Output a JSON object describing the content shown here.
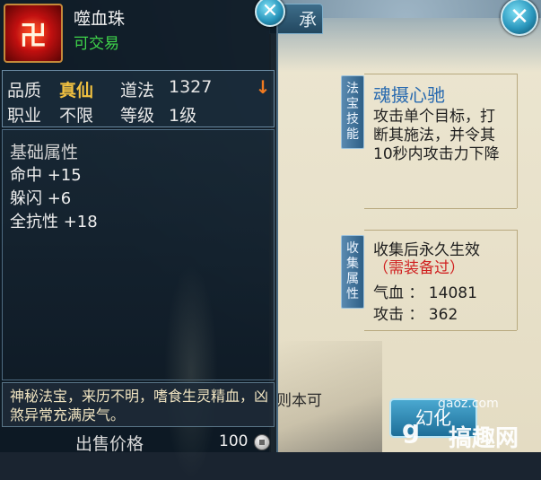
{
  "item": {
    "name": "噬血珠",
    "trade_status": "可交易",
    "icon_glyph": "卍",
    "icon_name": "blood-orb-icon"
  },
  "stats": {
    "quality_label": "品质",
    "quality_value": "真仙",
    "daofa_label": "道法",
    "daofa_value": "1327",
    "class_label": "职业",
    "class_value": "不限",
    "level_label": "等级",
    "level_value": "1级"
  },
  "attributes": {
    "heading": "基础属性",
    "lines": [
      "命中 +15",
      "躲闪 +6",
      "全抗性 +18"
    ]
  },
  "description": "神秘法宝，来历不明，嗜食生灵精血，凶煞异常充满戾气。",
  "sell": {
    "label": "出售价格",
    "price": "100"
  },
  "right_panel": {
    "tab_partial": "承",
    "skill_tag": "法宝技能",
    "skill_name": "魂摄心驰",
    "skill_desc": "攻击单个目标，打断其施法，并令其10秒内攻击力下降",
    "collect_tag": "收集属性",
    "collect_title": "收集后永久生效",
    "collect_requirement": "（需装备过）",
    "collect_stats": [
      "气血 ： 14081",
      "攻击 ： 362"
    ],
    "partial_text": "则本可",
    "action_button": "幻化"
  },
  "watermark": {
    "site": "gaoz.com",
    "logo": "g",
    "name": "搞趣网"
  },
  "colors": {
    "quality_gold": "#f0c040",
    "trade_green": "#3fd44a",
    "requirement_red": "#d02020",
    "skill_blue": "#2a6bb0"
  }
}
